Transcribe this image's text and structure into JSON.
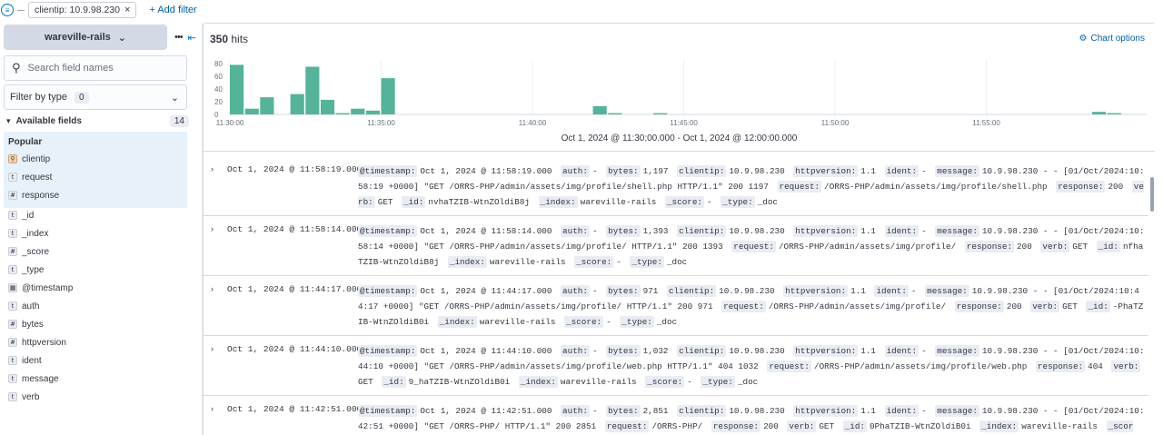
{
  "filterbar": {
    "filter_icon": "filter-menu-icon",
    "pill_label": "clientip: 10.9.98.230",
    "pill_close": "×",
    "add_filter": "+ Add filter"
  },
  "sidebar": {
    "data_view": "wareville-rails",
    "more": "•••",
    "collapse": "⇤",
    "search_placeholder": "Search field names",
    "filter_by_type": "Filter by type",
    "filter_count": "0",
    "available_fields": "Available fields",
    "available_count": "14",
    "popular_title": "Popular",
    "popular": [
      {
        "type": "ip",
        "icon": "⚲",
        "name": "clientip"
      },
      {
        "type": "text",
        "icon": "t",
        "name": "request"
      },
      {
        "type": "number",
        "icon": "#",
        "name": "response"
      }
    ],
    "fields": [
      {
        "type": "text",
        "icon": "t",
        "name": "_id"
      },
      {
        "type": "text",
        "icon": "t",
        "name": "_index"
      },
      {
        "type": "number",
        "icon": "#",
        "name": "_score"
      },
      {
        "type": "text",
        "icon": "t",
        "name": "_type"
      },
      {
        "type": "date",
        "icon": "▦",
        "name": "@timestamp"
      },
      {
        "type": "text",
        "icon": "t",
        "name": "auth"
      },
      {
        "type": "number",
        "icon": "#",
        "name": "bytes"
      },
      {
        "type": "number",
        "icon": "#",
        "name": "httpversion"
      },
      {
        "type": "text",
        "icon": "t",
        "name": "ident"
      },
      {
        "type": "text",
        "icon": "t",
        "name": "message"
      },
      {
        "type": "text",
        "icon": "t",
        "name": "verb"
      }
    ]
  },
  "main": {
    "hits_count": "350",
    "hits_label": "hits",
    "chart_options": "Chart options",
    "range": "Oct 1, 2024 @ 11:30:00.000 - Oct 1, 2024 @ 12:00:00.000"
  },
  "chart_data": {
    "type": "bar",
    "color": "#54b399",
    "ylim": [
      0,
      80
    ],
    "yticks": [
      "80",
      "60",
      "40",
      "20",
      "0"
    ],
    "xticks": [
      "11:30:00",
      "11:35:00",
      "11:40:00",
      "11:45:00",
      "11:50:00",
      "11:55:00"
    ],
    "interval_minutes": 0.5,
    "start": "11:30:00",
    "bars": [
      {
        "t": "11:30:00",
        "v": 78
      },
      {
        "t": "11:30:30",
        "v": 9
      },
      {
        "t": "11:31:00",
        "v": 27
      },
      {
        "t": "11:32:00",
        "v": 32
      },
      {
        "t": "11:32:30",
        "v": 75
      },
      {
        "t": "11:33:00",
        "v": 23
      },
      {
        "t": "11:33:30",
        "v": 2
      },
      {
        "t": "11:34:00",
        "v": 9
      },
      {
        "t": "11:34:30",
        "v": 6
      },
      {
        "t": "11:35:00",
        "v": 57
      },
      {
        "t": "11:42:00",
        "v": 13
      },
      {
        "t": "11:42:30",
        "v": 2
      },
      {
        "t": "11:44:00",
        "v": 2
      },
      {
        "t": "11:58:30",
        "v": 4
      },
      {
        "t": "11:59:00",
        "v": 2
      }
    ]
  },
  "documents": [
    {
      "timestamp": "Oct 1, 2024 @ 11:58:19.000",
      "fields": [
        [
          "@timestamp:",
          "Oct 1, 2024 @ 11:58:19.000"
        ],
        [
          "auth:",
          "-"
        ],
        [
          "bytes:",
          "1,197"
        ],
        [
          "clientip:",
          "10.9.98.230"
        ],
        [
          "httpversion:",
          "1.1"
        ],
        [
          "ident:",
          "-"
        ],
        [
          "message:",
          "10.9.98.230 - - [01/Oct/2024:10:58:19 +0000] \"GET /ORRS-PHP/admin/assets/img/profile/shell.php HTTP/1.1\" 200 1197"
        ],
        [
          "request:",
          "/ORRS-PHP/admin/assets/img/profile/shell.php"
        ],
        [
          "response:",
          "200"
        ],
        [
          "verb:",
          "GET"
        ],
        [
          "_id:",
          "nvhaTZIB-WtnZOldiB8j"
        ],
        [
          "_index:",
          "wareville-rails"
        ],
        [
          "_score:",
          "-"
        ],
        [
          "_type:",
          "_doc"
        ]
      ]
    },
    {
      "timestamp": "Oct 1, 2024 @ 11:58:14.000",
      "fields": [
        [
          "@timestamp:",
          "Oct 1, 2024 @ 11:58:14.000"
        ],
        [
          "auth:",
          "-"
        ],
        [
          "bytes:",
          "1,393"
        ],
        [
          "clientip:",
          "10.9.98.230"
        ],
        [
          "httpversion:",
          "1.1"
        ],
        [
          "ident:",
          "-"
        ],
        [
          "message:",
          "10.9.98.230 - - [01/Oct/2024:10:58:14 +0000] \"GET /ORRS-PHP/admin/assets/img/profile/ HTTP/1.1\" 200 1393"
        ],
        [
          "request:",
          "/ORRS-PHP/admin/assets/img/profile/"
        ],
        [
          "response:",
          "200"
        ],
        [
          "verb:",
          "GET"
        ],
        [
          "_id:",
          "nfhaTZIB-WtnZOldiB8j"
        ],
        [
          "_index:",
          "wareville-rails"
        ],
        [
          "_score:",
          "-"
        ],
        [
          "_type:",
          "_doc"
        ]
      ]
    },
    {
      "timestamp": "Oct 1, 2024 @ 11:44:17.000",
      "fields": [
        [
          "@timestamp:",
          "Oct 1, 2024 @ 11:44:17.000"
        ],
        [
          "auth:",
          "-"
        ],
        [
          "bytes:",
          "971"
        ],
        [
          "clientip:",
          "10.9.98.230"
        ],
        [
          "httpversion:",
          "1.1"
        ],
        [
          "ident:",
          "-"
        ],
        [
          "message:",
          "10.9.98.230 - - [01/Oct/2024:10:44:17 +0000] \"GET /ORRS-PHP/admin/assets/img/profile/ HTTP/1.1\" 200 971"
        ],
        [
          "request:",
          "/ORRS-PHP/admin/assets/img/profile/"
        ],
        [
          "response:",
          "200"
        ],
        [
          "verb:",
          "GET"
        ],
        [
          "_id:",
          "-PhaTZIB-WtnZOldiB0i"
        ],
        [
          "_index:",
          "wareville-rails"
        ],
        [
          "_score:",
          "-"
        ],
        [
          "_type:",
          "_doc"
        ]
      ]
    },
    {
      "timestamp": "Oct 1, 2024 @ 11:44:10.000",
      "fields": [
        [
          "@timestamp:",
          "Oct 1, 2024 @ 11:44:10.000"
        ],
        [
          "auth:",
          "-"
        ],
        [
          "bytes:",
          "1,032"
        ],
        [
          "clientip:",
          "10.9.98.230"
        ],
        [
          "httpversion:",
          "1.1"
        ],
        [
          "ident:",
          "-"
        ],
        [
          "message:",
          "10.9.98.230 - - [01/Oct/2024:10:44:10 +0000] \"GET /ORRS-PHP/admin/assets/img/profile/web.php HTTP/1.1\" 404 1032"
        ],
        [
          "request:",
          "/ORRS-PHP/admin/assets/img/profile/web.php"
        ],
        [
          "response:",
          "404"
        ],
        [
          "verb:",
          "GET"
        ],
        [
          "_id:",
          "9_haTZIB-WtnZOldiB0i"
        ],
        [
          "_index:",
          "wareville-rails"
        ],
        [
          "_score:",
          "-"
        ],
        [
          "_type:",
          "_doc"
        ]
      ]
    },
    {
      "timestamp": "Oct 1, 2024 @ 11:42:51.000",
      "fields": [
        [
          "@timestamp:",
          "Oct 1, 2024 @ 11:42:51.000"
        ],
        [
          "auth:",
          "-"
        ],
        [
          "bytes:",
          "2,851"
        ],
        [
          "clientip:",
          "10.9.98.230"
        ],
        [
          "httpversion:",
          "1.1"
        ],
        [
          "ident:",
          "-"
        ],
        [
          "message:",
          "10.9.98.230 - - [01/Oct/2024:10:42:51 +0000] \"GET /ORRS-PHP/ HTTP/1.1\" 200 2851"
        ],
        [
          "request:",
          "/ORRS-PHP/"
        ],
        [
          "response:",
          "200"
        ],
        [
          "verb:",
          "GET"
        ],
        [
          "_id:",
          "0PhaTZIB-WtnZOldiB0i"
        ],
        [
          "_index:",
          "wareville-rails"
        ],
        [
          "_score:",
          "-"
        ],
        [
          "_type:",
          "_doc"
        ]
      ]
    }
  ]
}
